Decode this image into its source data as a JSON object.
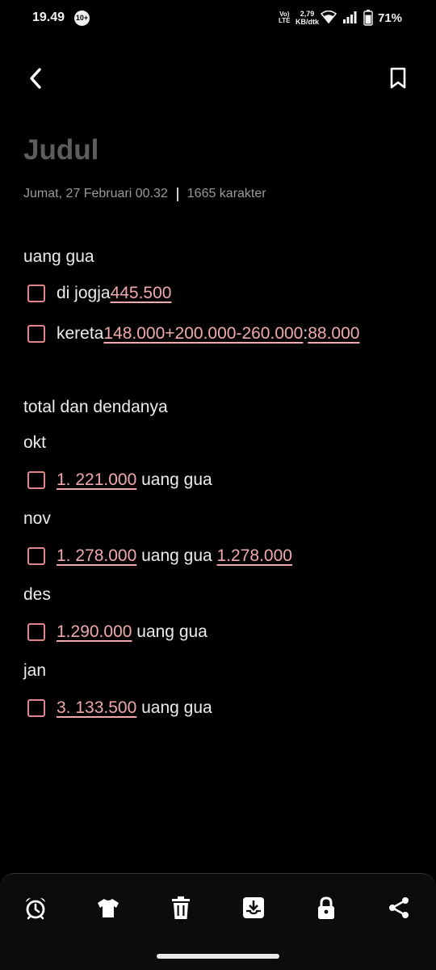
{
  "status_bar": {
    "time": "19.49",
    "notif_badge": "10+",
    "volte_top": "Vo)",
    "volte_bottom": "LTE",
    "speed_value": "2,79",
    "speed_unit": "KB/dtk",
    "battery_pct": "71%"
  },
  "app_bar": {
    "back_icon": "chevron-left-icon",
    "bookmark_icon": "bookmark-icon"
  },
  "note": {
    "title": "Judul",
    "date": "Jumat, 27 Februari 00.32",
    "chars": "1665 karakter"
  },
  "content": {
    "section1_heading": "uang gua",
    "item1": {
      "label": "di jogja ",
      "num": "445.500"
    },
    "item2": {
      "label": "kereta ",
      "formula": "148.000+200.000-260.000",
      "sep": ": ",
      "result": "88.000"
    },
    "section2_heading": "total dan dendanya",
    "month_okt": "okt",
    "item_okt": {
      "num": "1. 221.000",
      "label": " uang gua"
    },
    "month_nov": "nov",
    "item_nov": {
      "num": "1. 278.000",
      "label": " uang gua ",
      "num2": "1.278.000"
    },
    "month_des": "des",
    "item_des": {
      "num": "1.290.000",
      "label": " uang gua"
    },
    "month_jan": "jan",
    "item_jan": {
      "num": "3. 133.500",
      "label": " uang gua"
    }
  },
  "bottom_bar": {
    "icons": [
      "alarm-icon",
      "shirt-icon",
      "trash-icon",
      "download-icon",
      "lock-icon",
      "share-icon"
    ]
  },
  "colors": {
    "accent": "#e1858c",
    "link": "#f1a9ae",
    "background": "#000000",
    "title": "#5d5d5d"
  }
}
